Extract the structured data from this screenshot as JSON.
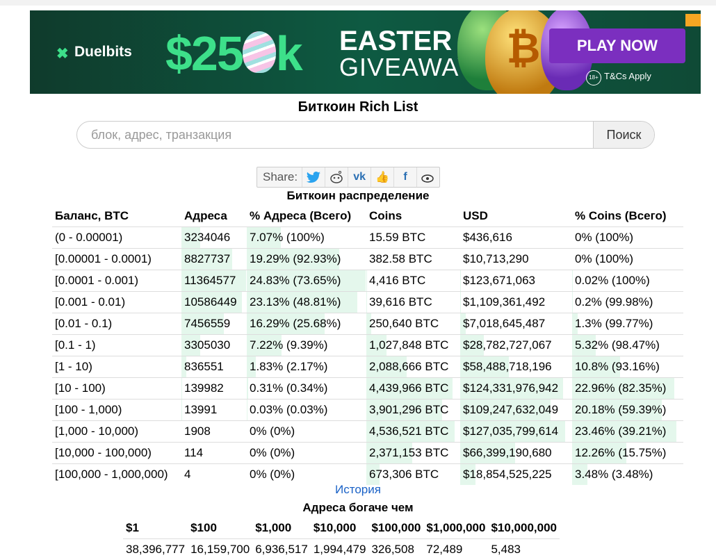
{
  "ad": {
    "brand": "Duelbits",
    "amount_left": "$25",
    "amount_right": "k",
    "headline1": "EASTER",
    "headline2": "GIVEAWAY",
    "cta": "PLAY NOW",
    "age": "18+",
    "terms": "T&Cs Apply",
    "egg_symbol": "₿"
  },
  "page": {
    "title": "Биткоин Rich List"
  },
  "search": {
    "placeholder": "блок, адрес, транзакция",
    "button": "Поиск"
  },
  "share": {
    "label": "Share:",
    "icons": [
      "twitter-icon",
      "reddit-icon",
      "vk-icon",
      "like-icon",
      "facebook-icon",
      "weibo-icon"
    ]
  },
  "distribution": {
    "title": "Биткоин распределение",
    "headers": [
      "Баланс, BTC",
      "Адреса",
      "% Адреса (Всего)",
      "Coins",
      "USD",
      "% Coins (Всего)"
    ],
    "rows": [
      {
        "range": "(0 - 0.00001)",
        "addresses": "3234046",
        "addr_pct": "7.07% (100%)",
        "coins": "15.59 BTC",
        "usd": "$436,616",
        "coins_pct": "0% (100%)",
        "addr_share": 7.07,
        "coins_share": 0
      },
      {
        "range": "[0.00001 - 0.0001)",
        "addresses": "8827737",
        "addr_pct": "19.29% (92.93%)",
        "coins": "382.58 BTC",
        "usd": "$10,713,290",
        "coins_pct": "0% (100%)",
        "addr_share": 19.29,
        "coins_share": 0
      },
      {
        "range": "[0.0001 - 0.001)",
        "addresses": "11364577",
        "addr_pct": "24.83% (73.65%)",
        "coins": "4,416 BTC",
        "usd": "$123,671,063",
        "coins_pct": "0.02% (100%)",
        "addr_share": 24.83,
        "coins_share": 0.02
      },
      {
        "range": "[0.001 - 0.01)",
        "addresses": "10586449",
        "addr_pct": "23.13% (48.81%)",
        "coins": "39,616 BTC",
        "usd": "$1,109,361,492",
        "coins_pct": "0.2% (99.98%)",
        "addr_share": 23.13,
        "coins_share": 0.2
      },
      {
        "range": "[0.01 - 0.1)",
        "addresses": "7456559",
        "addr_pct": "16.29% (25.68%)",
        "coins": "250,640 BTC",
        "usd": "$7,018,645,487",
        "coins_pct": "1.3% (99.77%)",
        "addr_share": 16.29,
        "coins_share": 1.3
      },
      {
        "range": "[0.1 - 1)",
        "addresses": "3305030",
        "addr_pct": "7.22% (9.39%)",
        "coins": "1,027,848 BTC",
        "usd": "$28,782,727,067",
        "coins_pct": "5.32% (98.47%)",
        "addr_share": 7.22,
        "coins_share": 5.32
      },
      {
        "range": "[1 - 10)",
        "addresses": "836551",
        "addr_pct": "1.83% (2.17%)",
        "coins": "2,088,666 BTC",
        "usd": "$58,488,718,196",
        "coins_pct": "10.8% (93.16%)",
        "addr_share": 1.83,
        "coins_share": 10.8
      },
      {
        "range": "[10 - 100)",
        "addresses": "139982",
        "addr_pct": "0.31% (0.34%)",
        "coins": "4,439,966 BTC",
        "usd": "$124,331,976,942",
        "coins_pct": "22.96% (82.35%)",
        "addr_share": 0.31,
        "coins_share": 22.96
      },
      {
        "range": "[100 - 1,000)",
        "addresses": "13991",
        "addr_pct": "0.03% (0.03%)",
        "coins": "3,901,296 BTC",
        "usd": "$109,247,632,049",
        "coins_pct": "20.18% (59.39%)",
        "addr_share": 0.03,
        "coins_share": 20.18
      },
      {
        "range": "[1,000 - 10,000)",
        "addresses": "1908",
        "addr_pct": "0% (0%)",
        "coins": "4,536,521 BTC",
        "usd": "$127,035,799,614",
        "coins_pct": "23.46% (39.21%)",
        "addr_share": 0,
        "coins_share": 23.46
      },
      {
        "range": "[10,000 - 100,000)",
        "addresses": "114",
        "addr_pct": "0% (0%)",
        "coins": "2,371,153 BTC",
        "usd": "$66,399,190,680",
        "coins_pct": "12.26% (15.75%)",
        "addr_share": 0,
        "coins_share": 12.26
      },
      {
        "range": "[100,000 - 1,000,000)",
        "addresses": "4",
        "addr_pct": "0% (0%)",
        "coins": "673,306 BTC",
        "usd": "$18,854,525,225",
        "coins_pct": "3.48% (3.48%)",
        "addr_share": 0,
        "coins_share": 3.48
      }
    ]
  },
  "history_link": "История",
  "richer": {
    "title": "Адреса богаче чем",
    "headers": [
      "$1",
      "$100",
      "$1,000",
      "$10,000",
      "$100,000",
      "$1,000,000",
      "$10,000,000"
    ],
    "values": [
      "38,396,777",
      "16,159,700",
      "6,936,517",
      "1,994,479",
      "326,508",
      "72,489",
      "5,483"
    ]
  },
  "colors": {
    "bar": "#e4f7ec",
    "link": "#1a62c7",
    "ad_bg": "#0e5a42",
    "cta": "#7b2fbf"
  }
}
